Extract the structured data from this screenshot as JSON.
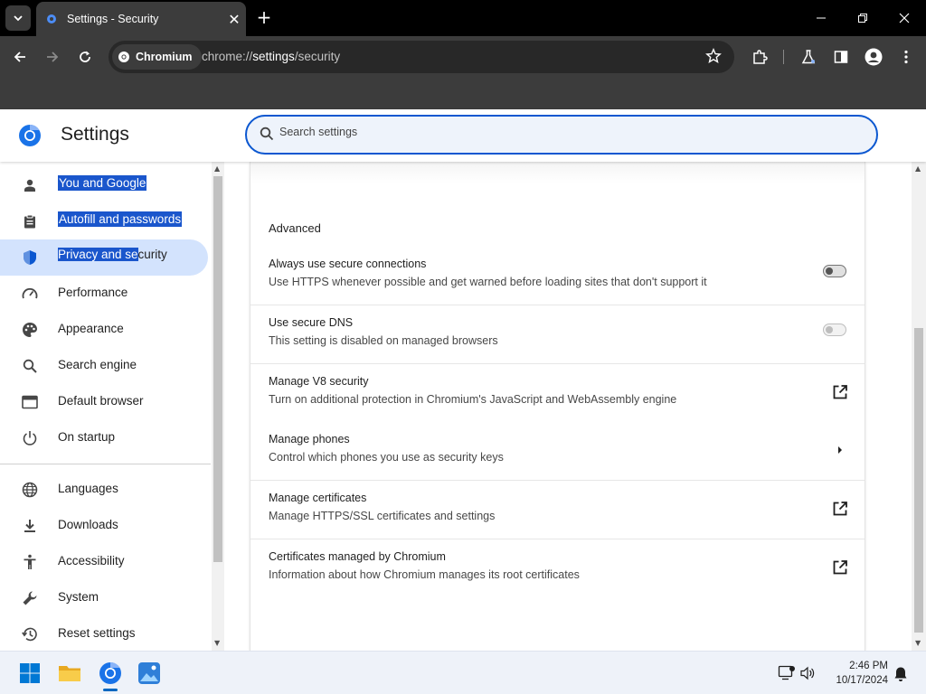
{
  "browser": {
    "tab_title": "Settings - Security",
    "chip_label": "Chromium",
    "url_scheme": "chrome://",
    "url_host": "settings",
    "url_path": "/security"
  },
  "header": {
    "title": "Settings",
    "search_placeholder": "Search settings"
  },
  "sidebar": {
    "items": [
      {
        "label": "You and Google",
        "icon": "person-icon"
      },
      {
        "label": "Autofill and passwords",
        "icon": "clipboard-icon"
      },
      {
        "label_highlighted": "Privacy and se",
        "label_rest": "curity",
        "icon": "shield-icon"
      },
      {
        "label": "Performance",
        "icon": "speedometer-icon"
      },
      {
        "label": "Appearance",
        "icon": "palette-icon"
      },
      {
        "label": "Search engine",
        "icon": "search-icon"
      },
      {
        "label": "Default browser",
        "icon": "browser-window-icon"
      },
      {
        "label": "On startup",
        "icon": "power-icon"
      },
      {
        "label": "Languages",
        "icon": "globe-icon"
      },
      {
        "label": "Downloads",
        "icon": "download-icon"
      },
      {
        "label": "Accessibility",
        "icon": "accessibility-icon"
      },
      {
        "label": "System",
        "icon": "wrench-icon"
      },
      {
        "label": "Reset settings",
        "icon": "history-icon"
      }
    ]
  },
  "main": {
    "section_title": "Advanced",
    "rows": [
      {
        "title": "Always use secure connections",
        "desc": "Use HTTPS whenever possible and get warned before loading sites that don't support it",
        "control": "toggle"
      },
      {
        "title": "Use secure DNS",
        "desc": "This setting is disabled on managed browsers",
        "control": "toggle-disabled"
      },
      {
        "title": "Manage V8 security",
        "desc": "Turn on additional protection in Chromium's JavaScript and WebAssembly engine",
        "control": "external-link-icon"
      },
      {
        "title": "Manage phones",
        "desc": "Control which phones you use as security keys",
        "control": "arrow-right-icon"
      },
      {
        "title": "Manage certificates",
        "desc": "Manage HTTPS/SSL certificates and settings",
        "control": "external-link-icon"
      },
      {
        "title": "Certificates managed by Chromium",
        "desc": "Information about how Chromium manages its root certificates",
        "control": "external-link-icon"
      }
    ]
  },
  "taskbar": {
    "time": "2:46 PM",
    "date": "10/17/2024"
  },
  "colors": {
    "accent": "#0b57d0",
    "active_nav_bg": "#d3e3fd",
    "selection": "#1a56cc",
    "chrome_dark": "#3c3c3c"
  }
}
